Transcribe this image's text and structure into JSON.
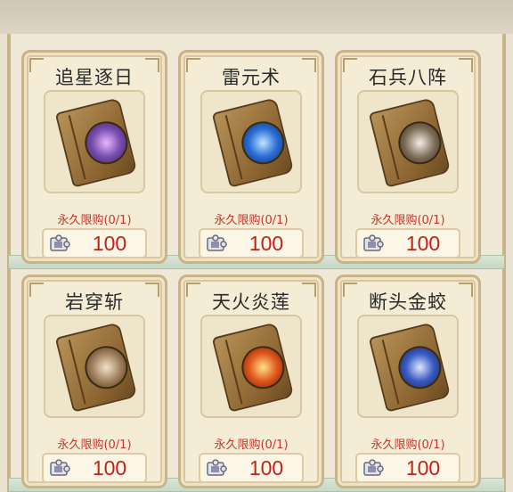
{
  "shop": {
    "items": [
      {
        "name": "追星逐日",
        "limit": "永久限购(0/1)",
        "price": "100",
        "art_color": "#7a4fb0"
      },
      {
        "name": "雷元术",
        "limit": "永久限购(0/1)",
        "price": "100",
        "art_color": "#2b6fd6"
      },
      {
        "name": "石兵八阵",
        "limit": "永久限购(0/1)",
        "price": "100",
        "art_color": "#7b6a55"
      },
      {
        "name": "岩穿斩",
        "limit": "永久限购(0/1)",
        "price": "100",
        "art_color": "#9a7a57"
      },
      {
        "name": "天火炎莲",
        "limit": "永久限购(0/1)",
        "price": "100",
        "art_color": "#e0581e"
      },
      {
        "name": "断头金蛟",
        "limit": "永久限购(0/1)",
        "price": "100",
        "art_color": "#3a5cc4"
      }
    ],
    "currency_icon": "puzzle-piece-icon",
    "accent_red": "#c0221b"
  }
}
